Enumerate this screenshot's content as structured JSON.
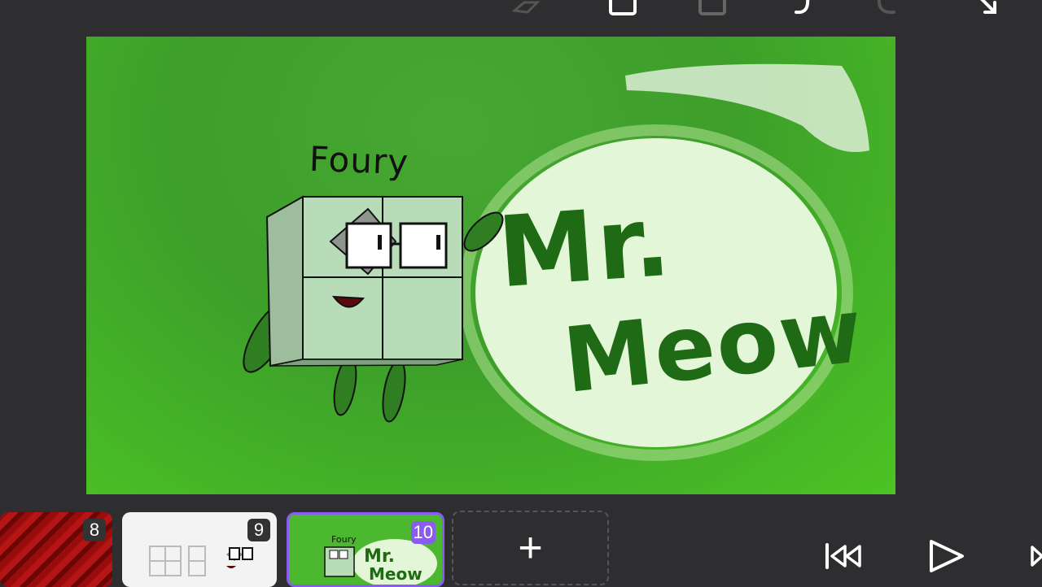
{
  "canvas": {
    "character_label": "Foury",
    "logo_line1": "Mr.",
    "logo_line2": "Meow"
  },
  "timeline": {
    "frames": [
      {
        "number": "8"
      },
      {
        "number": "9"
      },
      {
        "number": "10"
      }
    ],
    "add_label": "+"
  },
  "toolbar": {
    "icons": [
      "eraser-icon",
      "copy-icon",
      "paste-icon",
      "undo-icon",
      "redo-icon",
      "fullscreen-icon"
    ]
  },
  "playback": {
    "icons": [
      "skip-to-start-icon",
      "play-icon",
      "next-icon"
    ]
  },
  "colors": {
    "accent": "#8a5cf0",
    "background": "#2e2e30",
    "canvas_green": "#45aa2e"
  }
}
